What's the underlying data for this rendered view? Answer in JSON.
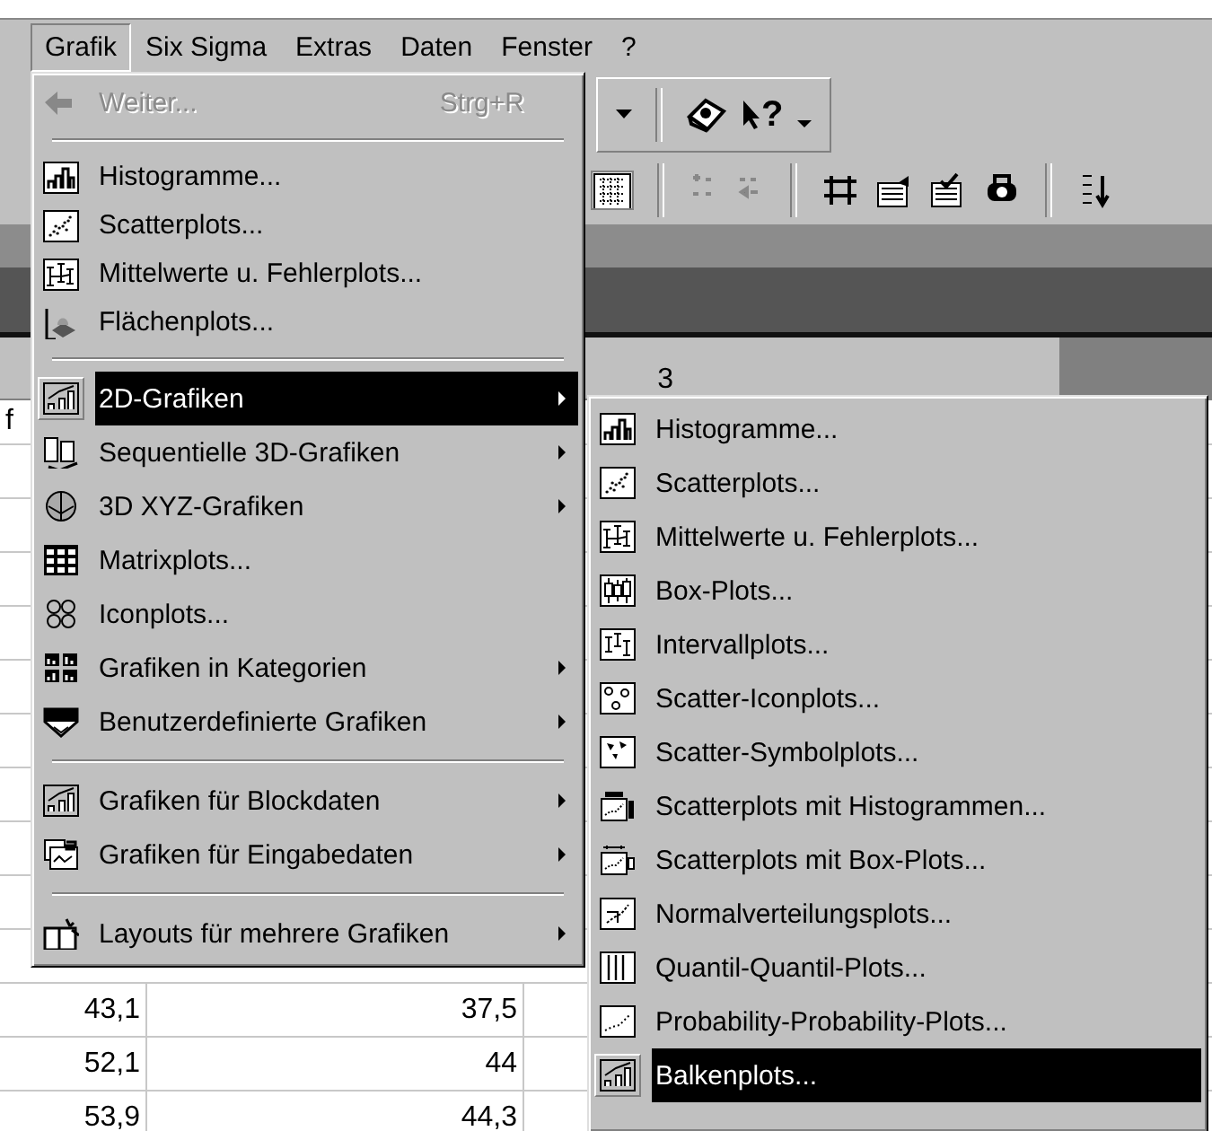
{
  "menu_bar": [
    {
      "label": "Grafik",
      "selected": true
    },
    {
      "label": "Six Sigma",
      "selected": false
    },
    {
      "label": "Extras",
      "selected": false
    },
    {
      "label": "Daten",
      "selected": false
    },
    {
      "label": "Fenster",
      "selected": false
    },
    {
      "label": "?",
      "selected": false
    }
  ],
  "toolbar": {
    "help_glyph": "?"
  },
  "spreadsheet": {
    "column_header": "3",
    "row_name_fragment": "f",
    "rows": [
      [
        "43,1",
        "37,5"
      ],
      [
        "52,1",
        "44"
      ],
      [
        "53,9",
        "44,3"
      ]
    ]
  },
  "menu": {
    "sections": [
      [
        {
          "label": "Weiter...",
          "shortcut": "Strg+R",
          "disabled": true,
          "selected": false,
          "submenu": false
        }
      ],
      [
        {
          "label": "Histogramme...",
          "disabled": false,
          "selected": false,
          "submenu": false
        },
        {
          "label": "Scatterplots...",
          "disabled": false,
          "selected": false,
          "submenu": false
        },
        {
          "label": "Mittelwerte u. Fehlerplots...",
          "disabled": false,
          "selected": false,
          "submenu": false
        },
        {
          "label": "Flächenplots...",
          "disabled": false,
          "selected": false,
          "submenu": false
        }
      ],
      [
        {
          "label": "2D-Grafiken",
          "disabled": false,
          "selected": true,
          "submenu": true
        },
        {
          "label": "Sequentielle 3D-Grafiken",
          "disabled": false,
          "selected": false,
          "submenu": true
        },
        {
          "label": "3D XYZ-Grafiken",
          "disabled": false,
          "selected": false,
          "submenu": true
        },
        {
          "label": "Matrixplots...",
          "disabled": false,
          "selected": false,
          "submenu": false
        },
        {
          "label": "Iconplots...",
          "disabled": false,
          "selected": false,
          "submenu": false
        },
        {
          "label": "Grafiken in Kategorien",
          "disabled": false,
          "selected": false,
          "submenu": true
        },
        {
          "label": "Benutzerdefinierte Grafiken",
          "disabled": false,
          "selected": false,
          "submenu": true
        }
      ],
      [
        {
          "label": "Grafiken für Blockdaten",
          "disabled": false,
          "selected": false,
          "submenu": true
        },
        {
          "label": "Grafiken für Eingabedaten",
          "disabled": false,
          "selected": false,
          "submenu": true
        }
      ],
      [
        {
          "label": "Layouts für mehrere Grafiken",
          "disabled": false,
          "selected": false,
          "submenu": true
        }
      ]
    ]
  },
  "submenu": {
    "items": [
      {
        "label": "Histogramme...",
        "selected": false
      },
      {
        "label": "Scatterplots...",
        "selected": false
      },
      {
        "label": "Mittelwerte u. Fehlerplots...",
        "selected": false
      },
      {
        "label": "Box-Plots...",
        "selected": false
      },
      {
        "label": "Intervallplots...",
        "selected": false
      },
      {
        "label": "Scatter-Iconplots...",
        "selected": false
      },
      {
        "label": "Scatter-Symbolplots...",
        "selected": false
      },
      {
        "label": "Scatterplots mit Histogrammen...",
        "selected": false
      },
      {
        "label": "Scatterplots mit Box-Plots...",
        "selected": false
      },
      {
        "label": "Normalverteilungsplots...",
        "selected": false
      },
      {
        "label": "Quantil-Quantil-Plots...",
        "selected": false
      },
      {
        "label": "Probability-Probability-Plots...",
        "selected": false
      },
      {
        "label": "Balkenplots...",
        "selected": true
      }
    ]
  }
}
